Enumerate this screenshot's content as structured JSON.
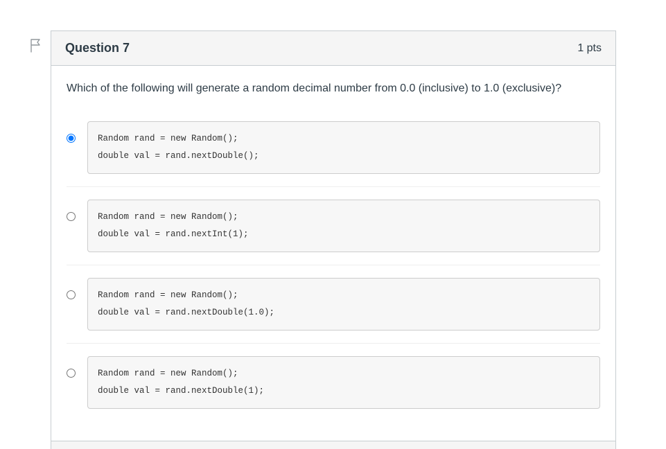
{
  "question": {
    "title": "Question 7",
    "points": "1 pts",
    "prompt": "Which of the following will generate a random decimal number from 0.0 (inclusive) to 1.0 (exclusive)?",
    "answers": [
      {
        "code": "Random rand = new Random();\ndouble val = rand.nextDouble();",
        "selected": true
      },
      {
        "code": "Random rand = new Random();\ndouble val = rand.nextInt(1);",
        "selected": false
      },
      {
        "code": "Random rand = new Random();\ndouble val = rand.nextDouble(1.0);",
        "selected": false
      },
      {
        "code": "Random rand = new Random();\ndouble val = rand.nextDouble(1);",
        "selected": false
      }
    ]
  }
}
